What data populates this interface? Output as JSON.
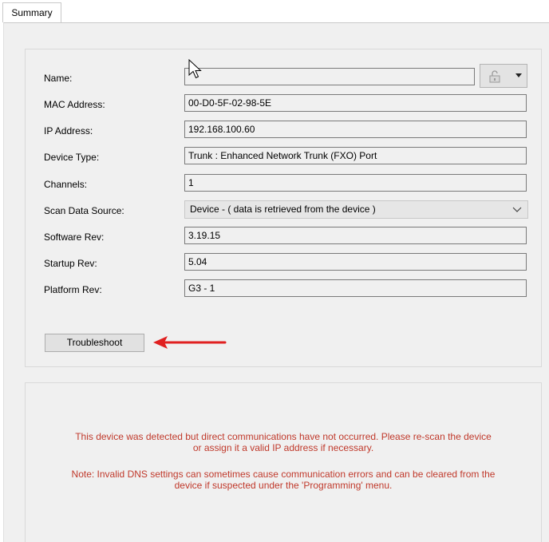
{
  "tabs": [
    {
      "label": "Summary"
    }
  ],
  "fields": {
    "name": {
      "label": "Name:",
      "value": ""
    },
    "mac": {
      "label": "MAC Address:",
      "value": "00-D0-5F-02-98-5E"
    },
    "ip": {
      "label": "IP Address:",
      "value": "192.168.100.60"
    },
    "device_type": {
      "label": "Device Type:",
      "value": "Trunk : Enhanced Network Trunk (FXO) Port"
    },
    "channels": {
      "label": "Channels:",
      "value": "1"
    },
    "scan_source": {
      "label": "Scan Data Source:",
      "value": "Device - ( data is retrieved from the device )"
    },
    "software_rev": {
      "label": "Software Rev:",
      "value": "3.19.15"
    },
    "startup_rev": {
      "label": "Startup Rev:",
      "value": "5.04"
    },
    "platform_rev": {
      "label": "Platform Rev:",
      "value": "G3 - 1"
    }
  },
  "buttons": {
    "troubleshoot": "Troubleshoot"
  },
  "messages": {
    "line1": "This device was detected but direct communications have not occurred.  Please re-scan the device",
    "line2": "or assign it a valid IP address if necessary.",
    "line3": "Note:  Invalid DNS settings can sometimes cause communication errors and can be cleared from the",
    "line4": "device if suspected under the 'Programming' menu."
  },
  "icons": {
    "lock": "unlock-icon",
    "dropdown": "chevron-down-icon",
    "arrow": "red-arrow-annotation",
    "cursor": "mouse-cursor"
  },
  "colors": {
    "message_text": "#c0392b",
    "arrow": "#e02020"
  }
}
